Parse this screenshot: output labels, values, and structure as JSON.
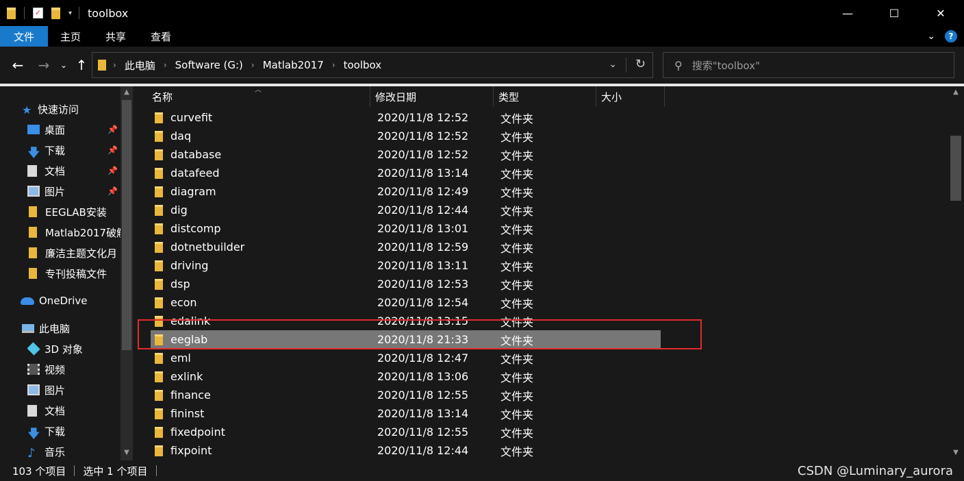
{
  "window": {
    "title": "toolbox",
    "minimize": "—",
    "maximize": "☐",
    "close": "✕"
  },
  "ribbon": {
    "tabs": [
      "文件",
      "主页",
      "共享",
      "查看"
    ]
  },
  "address": {
    "crumbs": [
      "此电脑",
      "Software (G:)",
      "Matlab2017",
      "toolbox"
    ],
    "search_placeholder": "搜索\"toolbox\""
  },
  "sidebar": {
    "items": [
      {
        "label": "快速访问",
        "icon": "star-icon",
        "pinned": false
      },
      {
        "label": "桌面",
        "icon": "desktop-icon",
        "pinned": true
      },
      {
        "label": "下载",
        "icon": "download-icon",
        "pinned": true
      },
      {
        "label": "文档",
        "icon": "document-icon",
        "pinned": true
      },
      {
        "label": "图片",
        "icon": "picture-icon",
        "pinned": true
      },
      {
        "label": "EEGLAB安装",
        "icon": "folder-icon",
        "pinned": false
      },
      {
        "label": "Matlab2017破解",
        "icon": "folder-icon",
        "pinned": false
      },
      {
        "label": "廉洁主题文化月",
        "icon": "folder-icon",
        "pinned": false
      },
      {
        "label": "专刊投稿文件",
        "icon": "folder-icon",
        "pinned": false
      },
      {
        "label": "OneDrive",
        "icon": "cloud-icon",
        "pinned": false
      },
      {
        "label": "此电脑",
        "icon": "computer-icon",
        "pinned": false
      },
      {
        "label": "3D 对象",
        "icon": "cube-icon",
        "pinned": false
      },
      {
        "label": "视频",
        "icon": "video-icon",
        "pinned": false
      },
      {
        "label": "图片",
        "icon": "picture-icon",
        "pinned": false
      },
      {
        "label": "文档",
        "icon": "document-icon",
        "pinned": false
      },
      {
        "label": "下载",
        "icon": "download-icon",
        "pinned": false
      },
      {
        "label": "音乐",
        "icon": "music-icon",
        "pinned": false
      }
    ]
  },
  "columns": {
    "name": "名称",
    "date": "修改日期",
    "type": "类型",
    "size": "大小"
  },
  "files": [
    {
      "name": "curvefit",
      "date": "2020/11/8 12:52",
      "type": "文件夹"
    },
    {
      "name": "daq",
      "date": "2020/11/8 12:52",
      "type": "文件夹"
    },
    {
      "name": "database",
      "date": "2020/11/8 12:52",
      "type": "文件夹"
    },
    {
      "name": "datafeed",
      "date": "2020/11/8 13:14",
      "type": "文件夹"
    },
    {
      "name": "diagram",
      "date": "2020/11/8 12:49",
      "type": "文件夹"
    },
    {
      "name": "dig",
      "date": "2020/11/8 12:44",
      "type": "文件夹"
    },
    {
      "name": "distcomp",
      "date": "2020/11/8 13:01",
      "type": "文件夹"
    },
    {
      "name": "dotnetbuilder",
      "date": "2020/11/8 12:59",
      "type": "文件夹"
    },
    {
      "name": "driving",
      "date": "2020/11/8 13:11",
      "type": "文件夹"
    },
    {
      "name": "dsp",
      "date": "2020/11/8 12:53",
      "type": "文件夹"
    },
    {
      "name": "econ",
      "date": "2020/11/8 12:54",
      "type": "文件夹"
    },
    {
      "name": "edalink",
      "date": "2020/11/8 13:15",
      "type": "文件夹"
    },
    {
      "name": "eeglab",
      "date": "2020/11/8 21:33",
      "type": "文件夹",
      "selected": true
    },
    {
      "name": "eml",
      "date": "2020/11/8 12:47",
      "type": "文件夹"
    },
    {
      "name": "exlink",
      "date": "2020/11/8 13:06",
      "type": "文件夹"
    },
    {
      "name": "finance",
      "date": "2020/11/8 12:55",
      "type": "文件夹"
    },
    {
      "name": "fininst",
      "date": "2020/11/8 13:14",
      "type": "文件夹"
    },
    {
      "name": "fixedpoint",
      "date": "2020/11/8 12:55",
      "type": "文件夹"
    },
    {
      "name": "fixpoint",
      "date": "2020/11/8 12:44",
      "type": "文件夹"
    }
  ],
  "status": {
    "count": "103 个项目",
    "selection": "选中 1 个项目"
  },
  "watermark": "CSDN @Luminary_aurora",
  "colors": {
    "accent": "#1979ca",
    "background": "#191919",
    "selected_row": "#777777",
    "highlight_box": "#e32b2b",
    "folder": "#e8b73c"
  }
}
